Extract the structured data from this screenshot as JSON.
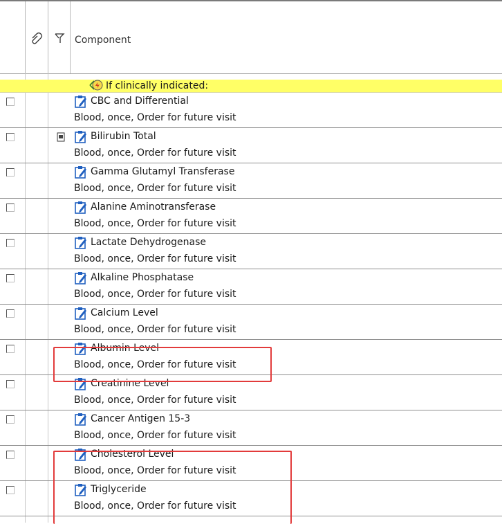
{
  "header": {
    "col_attach_icon": "paperclip-icon",
    "col_flag_icon": "flag-icon",
    "component_label": "Component"
  },
  "banner": {
    "icon": "clinical-indicator-icon",
    "text": "If clinically indicated:"
  },
  "rows": [
    {
      "name": "CBC and Differential",
      "detail": "Blood, once, Order for future visit",
      "has_note": false
    },
    {
      "name": "Bilirubin Total",
      "detail": "Blood, once, Order for future visit",
      "has_note": true
    },
    {
      "name": "Gamma Glutamyl Transferase",
      "detail": "Blood, once, Order for future visit",
      "has_note": false
    },
    {
      "name": "Alanine Aminotransferase",
      "detail": "Blood, once, Order for future visit",
      "has_note": false
    },
    {
      "name": "Lactate Dehydrogenase",
      "detail": "Blood, once, Order for future visit",
      "has_note": false
    },
    {
      "name": "Alkaline Phosphatase",
      "detail": "Blood, once, Order for future visit",
      "has_note": false
    },
    {
      "name": "Calcium Level",
      "detail": "Blood, once, Order for future visit",
      "has_note": false
    },
    {
      "name": "Albumin Level",
      "detail": "Blood, once, Order for future visit",
      "has_note": false
    },
    {
      "name": "Creatinine Level",
      "detail": "Blood, once, Order for future visit",
      "has_note": false
    },
    {
      "name": "Cancer Antigen 15-3",
      "detail": "Blood, once, Order for future visit",
      "has_note": false
    },
    {
      "name": "Cholesterol Level",
      "detail": "Blood, once, Order for future visit",
      "has_note": false
    },
    {
      "name": "Triglyceride",
      "detail": "Blood, once, Order for future visit",
      "has_note": false
    }
  ],
  "colors": {
    "banner_bg": "#ffff66",
    "highlight": "#e23b3b",
    "clipboard_blue": "#1f5fbf"
  }
}
